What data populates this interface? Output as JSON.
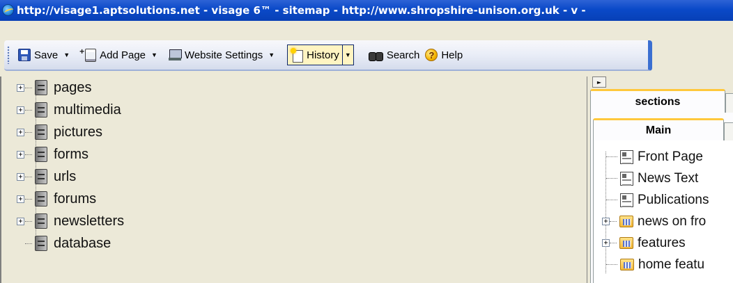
{
  "window": {
    "title": "http://visage1.aptsolutions.net - visage 6™ - sitemap - http://www.shropshire-unison.org.uk - v -"
  },
  "toolbar": {
    "save_label": "Save",
    "add_page_label": "Add Page",
    "website_settings_label": "Website Settings",
    "history_label": "History",
    "search_label": "Search",
    "help_label": "Help"
  },
  "tree": {
    "items": [
      {
        "label": "pages",
        "expandable": true
      },
      {
        "label": "multimedia",
        "expandable": true
      },
      {
        "label": "pictures",
        "expandable": true
      },
      {
        "label": "forms",
        "expandable": true
      },
      {
        "label": "urls",
        "expandable": true
      },
      {
        "label": "forums",
        "expandable": true
      },
      {
        "label": "newsletters",
        "expandable": true
      },
      {
        "label": "database",
        "expandable": false
      }
    ]
  },
  "sections_panel": {
    "tab_label": "sections",
    "subtab_label": "Main",
    "items": [
      {
        "label": "Front Page",
        "type": "page"
      },
      {
        "label": "News Text",
        "type": "page"
      },
      {
        "label": "Publications",
        "type": "page"
      },
      {
        "label": "news on fro",
        "type": "folder"
      },
      {
        "label": "features",
        "type": "folder"
      },
      {
        "label": "home featu",
        "type": "folder"
      }
    ]
  },
  "icons": {
    "expand_glyph": "+",
    "dropdown_glyph": "▼",
    "collapse_glyph": "►"
  }
}
